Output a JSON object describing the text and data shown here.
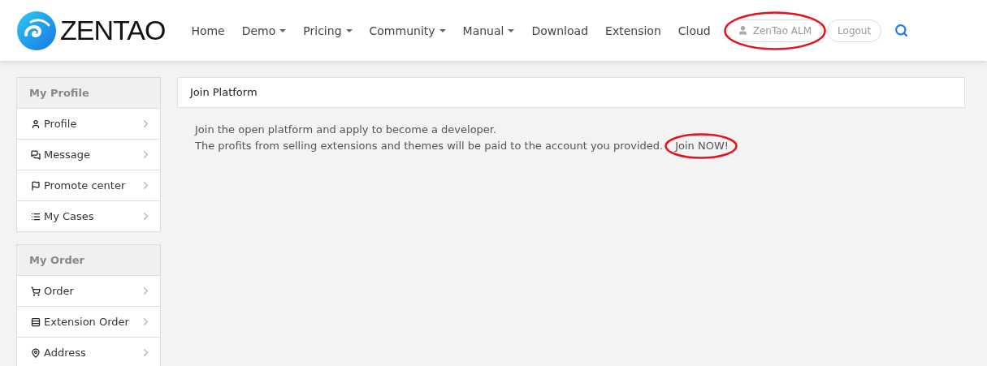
{
  "header": {
    "logo": "ZENTAO",
    "nav": [
      {
        "label": "Home",
        "dropdown": false
      },
      {
        "label": "Demo",
        "dropdown": true
      },
      {
        "label": "Pricing",
        "dropdown": true
      },
      {
        "label": "Community",
        "dropdown": true
      },
      {
        "label": "Manual",
        "dropdown": true
      },
      {
        "label": "Download",
        "dropdown": false
      },
      {
        "label": "Extension",
        "dropdown": false
      },
      {
        "label": "Cloud",
        "dropdown": false
      }
    ],
    "user": {
      "label": "ZenTao ALM",
      "highlighted": true
    },
    "logout": "Logout"
  },
  "sidebar": [
    {
      "title": "My Profile",
      "items": [
        "Profile",
        "Message",
        "Promote center",
        "My Cases"
      ]
    },
    {
      "title": "My Order",
      "items": [
        "Order",
        "Extension Order",
        "Address"
      ]
    }
  ],
  "panel": {
    "title": "Join Platform",
    "line_1": "Join the open platform and apply to become a developer.",
    "line_2": "The profits from selling extensions and themes will be paid to the account you provided.",
    "link": {
      "label": "Join NOW!",
      "highlighted": true
    }
  }
}
